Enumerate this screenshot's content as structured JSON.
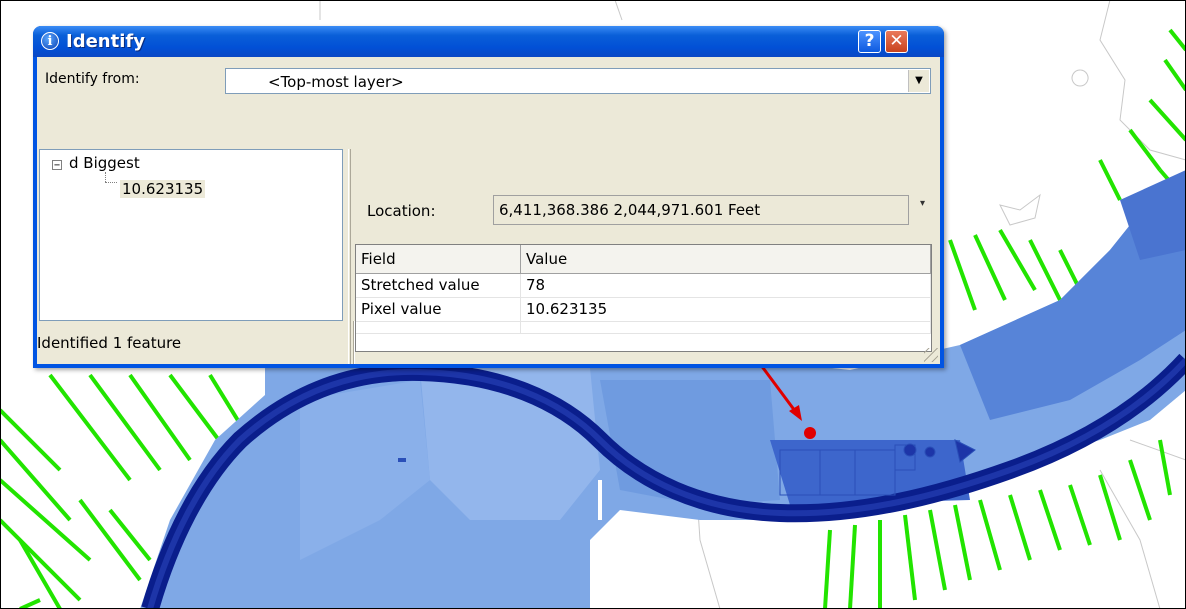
{
  "window": {
    "title": "Identify",
    "title_icon": "info-icon",
    "help_button": "?",
    "close_button": "✕"
  },
  "identify_from": {
    "label": "Identify from:",
    "value": "<Top-most layer>"
  },
  "tree": {
    "expander": "⊟",
    "root": "d Biggest",
    "child": "10.623135"
  },
  "location": {
    "label": "Location:",
    "value": "6,411,368.386  2,044,971.601 Feet"
  },
  "table": {
    "columns": [
      "Field",
      "Value"
    ],
    "rows": [
      {
        "field": "Stretched value",
        "value": "78"
      },
      {
        "field": "Pixel value",
        "value": "10.623135"
      }
    ]
  },
  "status": {
    "text": "Identified 1 feature"
  },
  "colors": {
    "title_bar": "#0054e3",
    "dialog_bg": "#ece9d8",
    "flood_light": "#7fa8e6",
    "river_dark": "#0a1e8c",
    "transect_green": "#22e400",
    "marker_red": "#e00000"
  }
}
